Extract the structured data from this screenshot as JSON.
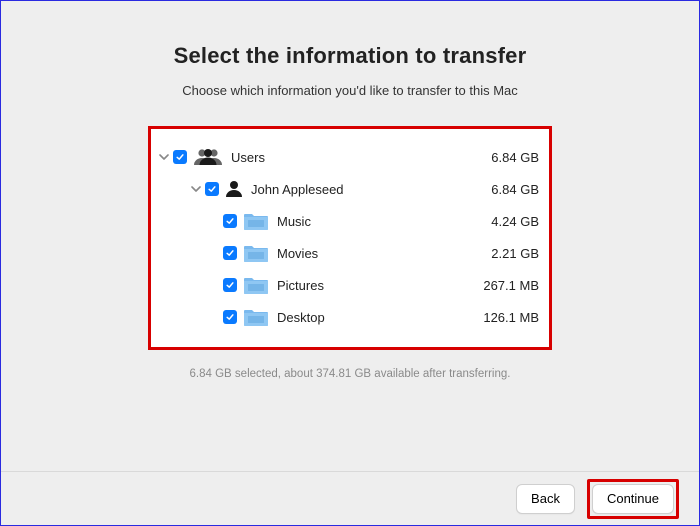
{
  "title": "Select the information to transfer",
  "subtitle": "Choose which information you'd like to transfer to this Mac",
  "tree": {
    "root": {
      "label": "Users",
      "size": "6.84 GB"
    },
    "user": {
      "label": "John Appleseed",
      "size": "6.84 GB"
    },
    "items": [
      {
        "label": "Music",
        "size": "4.24 GB"
      },
      {
        "label": "Movies",
        "size": "2.21 GB"
      },
      {
        "label": "Pictures",
        "size": "267.1 MB"
      },
      {
        "label": "Desktop",
        "size": "126.1 MB"
      }
    ]
  },
  "status": "6.84 GB selected, about 374.81 GB available after transferring.",
  "buttons": {
    "back": "Back",
    "continue": "Continue"
  }
}
